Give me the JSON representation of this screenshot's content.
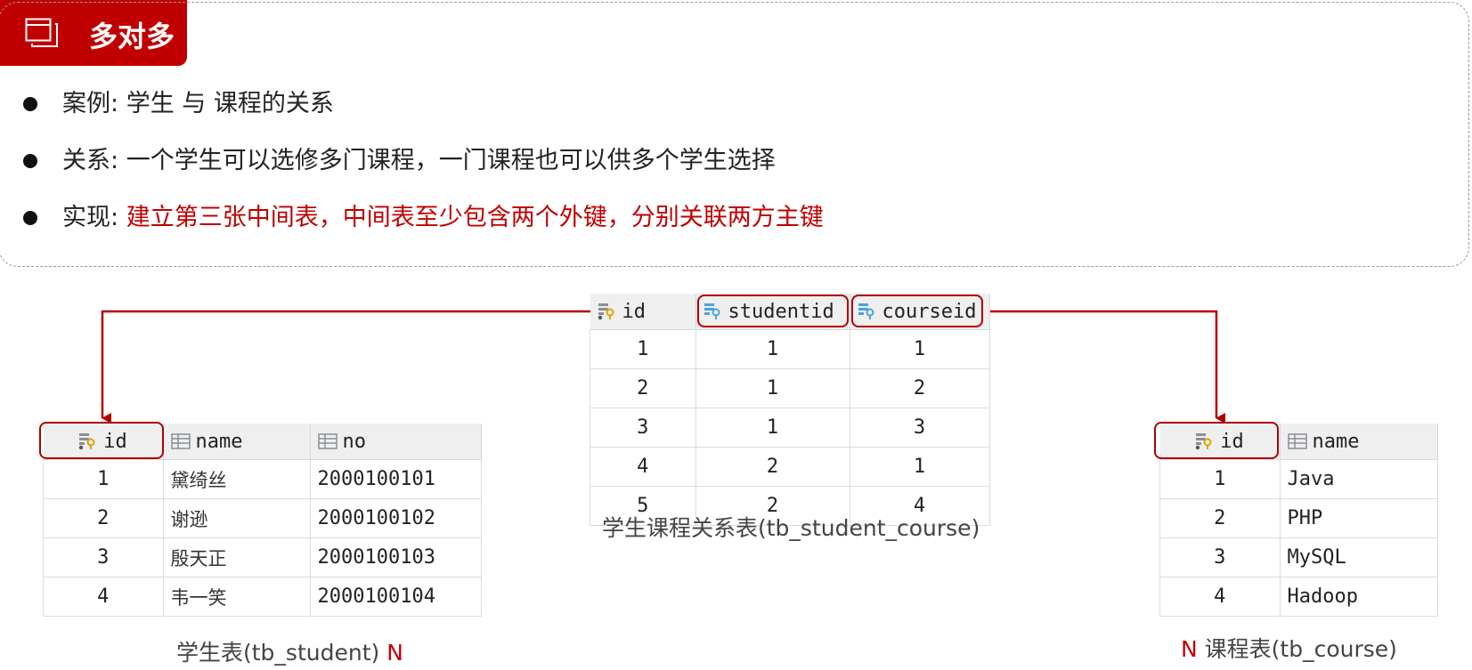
{
  "title": "多对多",
  "bullets": [
    {
      "label": "案例:",
      "text": " 学生 与 课程的关系",
      "highlight": ""
    },
    {
      "label": "关系:",
      "text": " 一个学生可以选修多门课程，一门课程也可以供多个学生选择",
      "highlight": ""
    },
    {
      "label": "实现:",
      "text": " ",
      "highlight": "建立第三张中间表，中间表至少包含两个外键，分别关联两方主键"
    }
  ],
  "student_table": {
    "columns": [
      "id",
      "name",
      "no"
    ],
    "rows": [
      [
        "1",
        "黛绮丝",
        "2000100101"
      ],
      [
        "2",
        "谢逊",
        "2000100102"
      ],
      [
        "3",
        "殷天正",
        "2000100103"
      ],
      [
        "4",
        "韦一笑",
        "2000100104"
      ]
    ],
    "caption": "学生表(tb_student)",
    "cardinality": "N"
  },
  "relation_table": {
    "columns": [
      "id",
      "studentid",
      "courseid"
    ],
    "rows": [
      [
        "1",
        "1",
        "1"
      ],
      [
        "2",
        "1",
        "2"
      ],
      [
        "3",
        "1",
        "3"
      ],
      [
        "4",
        "2",
        "1"
      ],
      [
        "5",
        "2",
        "4"
      ]
    ],
    "caption": "学生课程关系表(tb_student_course)"
  },
  "course_table": {
    "columns": [
      "id",
      "name"
    ],
    "rows": [
      [
        "1",
        "Java"
      ],
      [
        "2",
        "PHP"
      ],
      [
        "3",
        "MySQL"
      ],
      [
        "4",
        "Hadoop"
      ]
    ],
    "caption": "课程表(tb_course)",
    "cardinality": "N"
  },
  "icons": {
    "title": "stacked-windows-icon",
    "primary_key_column": "primary-key-column-icon",
    "foreign_key_column": "foreign-key-column-icon",
    "column": "column-icon"
  },
  "colors": {
    "accent": "#c00000",
    "highlight_border": "#b00000"
  }
}
